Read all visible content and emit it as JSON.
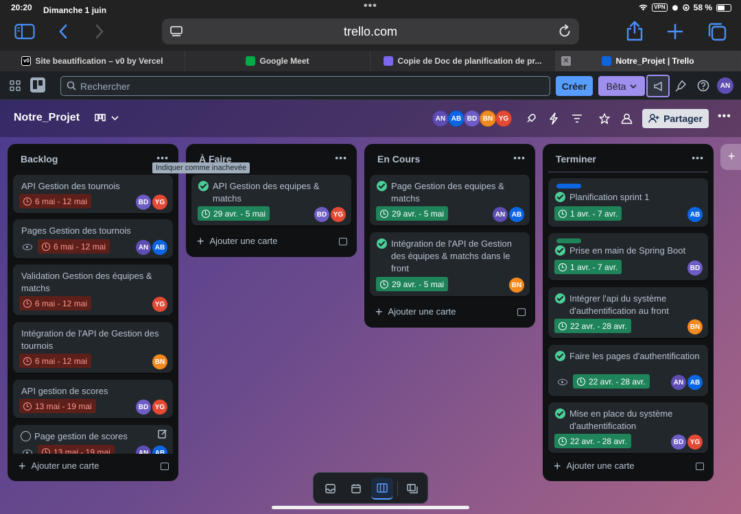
{
  "status": {
    "time": "20:20",
    "date": "Dimanche 1 juin",
    "vpn": "VPN",
    "battery": "58 %",
    "battery_level": 0.58
  },
  "browser": {
    "url": "trello.com"
  },
  "tabs": [
    {
      "label": "Site beautification – v0 by Vercel",
      "favicon_color": "#000000"
    },
    {
      "label": "Google Meet",
      "favicon_color": "#00ac47"
    },
    {
      "label": "Copie de Doc de planification de pr...",
      "favicon_color": "#7b68ee"
    },
    {
      "label": "Notre_Projet | Trello",
      "favicon_color": "#0c66e4"
    }
  ],
  "nav": {
    "search_placeholder": "Rechercher",
    "create": "Créer",
    "beta": "Bêta",
    "user_initials": "AN"
  },
  "board": {
    "title": "Notre_Projet",
    "share": "Partager",
    "members": [
      {
        "initials": "AN",
        "color": "#5e4db2"
      },
      {
        "initials": "AB",
        "color": "#0c66e4"
      },
      {
        "initials": "BD",
        "color": "#6e5dc6"
      },
      {
        "initials": "BN",
        "color": "#f38a1f"
      },
      {
        "initials": "YG",
        "color": "#e34935"
      }
    ]
  },
  "tooltip": "Indiquer comme inachevée",
  "add_card": "Ajouter une carte",
  "lists": [
    {
      "title": "Backlog",
      "cards": [
        {
          "title": "API Gestion des tournois",
          "date": "6 mai - 12 mai",
          "members": [
            "BD",
            "YG"
          ]
        },
        {
          "title": "Pages Gestion des tournois",
          "date": "6 mai - 12 mai",
          "members": [
            "AN",
            "AB"
          ]
        },
        {
          "title": "Validation Gestion des équipes & matchs",
          "date": "6 mai - 12 mai",
          "members": [
            "YG"
          ]
        },
        {
          "title": "Intégration de l'API de Gestion des tournois",
          "date": "6 mai - 12 mai",
          "members": [
            "BN"
          ]
        },
        {
          "title": "API gestion de scores",
          "date": "13 mai - 19 mai",
          "members": [
            "BD",
            "YG"
          ]
        },
        {
          "title": "Page gestion de scores",
          "date": "13 mai - 19 mai",
          "members": [
            "AN",
            "AB"
          ]
        }
      ]
    },
    {
      "title": "À Faire",
      "cards": [
        {
          "title": "API Gestion des equipes & matchs",
          "date": "29 avr. - 5 mai",
          "members": [
            "BD",
            "YG"
          ]
        }
      ]
    },
    {
      "title": "En Cours",
      "cards": [
        {
          "title": "Page Gestion des equipes & matchs",
          "date": "29 avr. - 5 mai",
          "members": [
            "AN",
            "AB"
          ]
        },
        {
          "title": "Intégration de l'API de Gestion des équipes & matchs dans le front",
          "date": "29 avr. - 5 mai",
          "members": [
            "BN"
          ]
        }
      ]
    },
    {
      "title": "Terminer",
      "cards": [
        {
          "title": "Planification sprint 1",
          "date": "1 avr. - 7 avr.",
          "members": [
            "AB"
          ],
          "label_color": "#0c66e4"
        },
        {
          "title": "Prise en main de Spring Boot",
          "date": "1 avr. - 7 avr.",
          "members": [
            "BD"
          ],
          "label_color": "#1f845a"
        },
        {
          "title": "Intégrer l'api du système d'authentification au front",
          "date": "22 avr. - 28 avr.",
          "members": [
            "BN"
          ]
        },
        {
          "title": "Faire les pages d'authentification",
          "date": "22 avr. - 28 avr.",
          "members": [
            "AN",
            "AB"
          ]
        },
        {
          "title": "Mise en place du système d'authentification",
          "date": "22 avr. - 28 avr.",
          "members": [
            "BD",
            "YG"
          ]
        }
      ]
    }
  ],
  "colors": {
    "accent": "#579dff",
    "beta": "#9f8fef",
    "done_green": "#4bce97",
    "overdue_red": "#fd9891"
  },
  "icons": [
    "sidebar-icon",
    "back-icon",
    "forward-icon",
    "tabs-icon",
    "reload-icon",
    "share-icon",
    "plus-icon",
    "tab-overview-icon",
    "apps-icon",
    "trello-logo-icon",
    "search-icon",
    "megaphone-icon",
    "bell-icon",
    "help-icon",
    "board-view-icon",
    "chevron-down-icon",
    "power-up-icon",
    "automation-icon",
    "filter-icon",
    "star-icon",
    "visibility-icon",
    "more-icon",
    "clock-icon",
    "eye-icon",
    "template-icon",
    "inbox-icon",
    "calendar-icon",
    "board-icon",
    "switch-boards-icon"
  ]
}
